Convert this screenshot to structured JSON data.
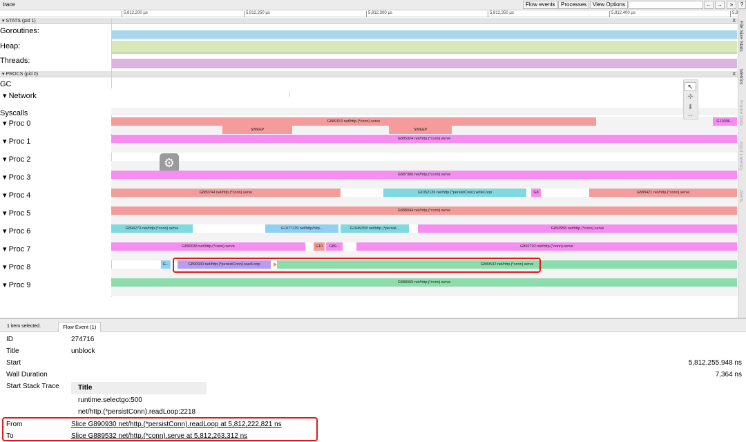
{
  "app": {
    "title": "trace"
  },
  "toolbar": {
    "flow_events": "Flow events",
    "processes": "Processes",
    "view_options": "View Options",
    "search_placeholder": "",
    "prev": "←",
    "next": "→",
    "more": "»",
    "help": "?"
  },
  "ruler": {
    "ticks": [
      "5,812,200 µs",
      "5,812,250 µs",
      "5,812,300 µs",
      "5,812,350 µs",
      "5,812,400 µs",
      "5,8"
    ]
  },
  "stats": {
    "header": "▾ STATS (pid 1)",
    "close": "X",
    "rows": [
      "Goroutines:",
      "Heap:",
      "Threads:"
    ],
    "colors": {
      "goroutines": "#a8d6ec",
      "heap": "#d8e8b8",
      "threads": "#d9b4dc"
    }
  },
  "procs": {
    "header": "▾ PROCS (pid 0)",
    "close": "X",
    "gc_label": "GC",
    "network_label": "Network",
    "syscalls_label": "Syscalls",
    "proc_labels": [
      "Proc 0",
      "Proc 1",
      "Proc 2",
      "Proc 3",
      "Proc 4",
      "Proc 5",
      "Proc 6",
      "Proc 7",
      "Proc 8",
      "Proc 9"
    ]
  },
  "slices": {
    "p0_main": "G889153 net/http.(*conn).serve",
    "p0_right": "G10396...",
    "p0_sweep1": "SWEEP",
    "p0_sweep2": "SWEEP",
    "p1_main": "G885924 net/http.(*conn).serve",
    "p3_main": "G887386 net/http.(*conn).serve",
    "p4_a": "G889744 net/http.(*conn).serve",
    "p4_b": "G1052126 net/http.(*persistConn).writeLoop",
    "p4_c": "G8",
    "p4_d": "G888421 net/http.(*conn).serve",
    "p5_main": "G888044 net/http.(*conn).serve",
    "p6_a": "G894273 net/http.(*conn).serve",
    "p6_b": "G1077139 net/http/http...",
    "p6_c": "G1049358 net/http.(*persist...",
    "p6_d": "G893958 net/http.(*conn).serve",
    "p7_a": "G890038 net/http.(*conn).serve",
    "p7_b": "G10",
    "p7_c": "G89...",
    "p7_d": "G892792 net/http.(*conn).serve",
    "p8_a": "G...",
    "p8_b": "G890930 net/http.(*persistConn).readLoop",
    "p8_c": "G889532 net/http.(*conn).serve",
    "p9_main": "G888009 net/http.(*conn).serve"
  },
  "sidebar_tabs": [
    "File Size Stats",
    "Metrics",
    "Frame Data",
    "Input Latency",
    "Alerts"
  ],
  "mode_icons": [
    "pointer-icon",
    "pan-icon",
    "zoom-icon",
    "timing-icon"
  ],
  "bottom": {
    "selection_count": "1 item selected.",
    "tab": "Flow Event (1)",
    "details": {
      "id_label": "ID",
      "id_value": "274716",
      "title_label": "Title",
      "title_value": "unblock",
      "start_label": "Start",
      "start_value": "5,812,255,948 ns",
      "wall_label": "Wall Duration",
      "wall_value": "7,364 ns",
      "stack_label": "Start Stack Trace",
      "stack_header": "Title",
      "stack_lines": [
        "runtime.selectgo:500",
        "net/http.(*persistConn).readLoop:2218"
      ],
      "from_label": "From",
      "from_value": "Slice G890930 net/http.(*persistConn).readLoop at 5,812,222,821 ns",
      "to_label": "To",
      "to_value": "Slice G889532 net/http.(*conn).serve at 5,812,263,312 ns"
    }
  },
  "colors": {
    "salmon": "#f49c9c",
    "magenta": "#f58ef0",
    "teal": "#7fd9df",
    "sky": "#8fd0f3",
    "green": "#8ddcac",
    "purple": "#b89cf0",
    "highlight": "#e01818"
  }
}
